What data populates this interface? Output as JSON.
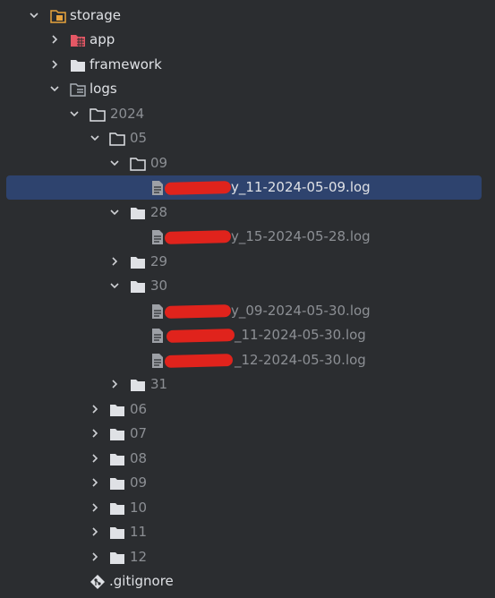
{
  "tree": {
    "storage": {
      "label": "storage",
      "icon": "folder-orange-icon"
    },
    "app": {
      "label": "app",
      "icon": "folder-red-grid-icon"
    },
    "framework": {
      "label": "framework",
      "icon": "folder-icon"
    },
    "logs": {
      "label": "logs",
      "icon": "folder-logs-icon"
    },
    "y2024": {
      "label": "2024"
    },
    "m05": {
      "label": "05"
    },
    "d09": {
      "label": "09"
    },
    "f_09_1": {
      "label": "y_11-2024-05-09.log"
    },
    "d28": {
      "label": "28"
    },
    "f_28_1": {
      "label": "y_15-2024-05-28.log"
    },
    "d29": {
      "label": "29"
    },
    "d30": {
      "label": "30"
    },
    "f_30_1": {
      "label": "y_09-2024-05-30.log"
    },
    "f_30_2": {
      "label": "_11-2024-05-30.log"
    },
    "f_30_3": {
      "label": "_12-2024-05-30.log"
    },
    "d31": {
      "label": "31"
    },
    "m06": {
      "label": "06"
    },
    "m07": {
      "label": "07"
    },
    "m08": {
      "label": "08"
    },
    "m09": {
      "label": "09"
    },
    "m10": {
      "label": "10"
    },
    "m11": {
      "label": "11"
    },
    "m12": {
      "label": "12"
    },
    "gitignore": {
      "label": ".gitignore",
      "icon": "git-icon"
    }
  },
  "colors": {
    "background": "#2b2d30",
    "selection": "#2e436e",
    "text": "#dfe1e5",
    "dim_text": "#8c8f94",
    "redaction": "#e0231c"
  }
}
